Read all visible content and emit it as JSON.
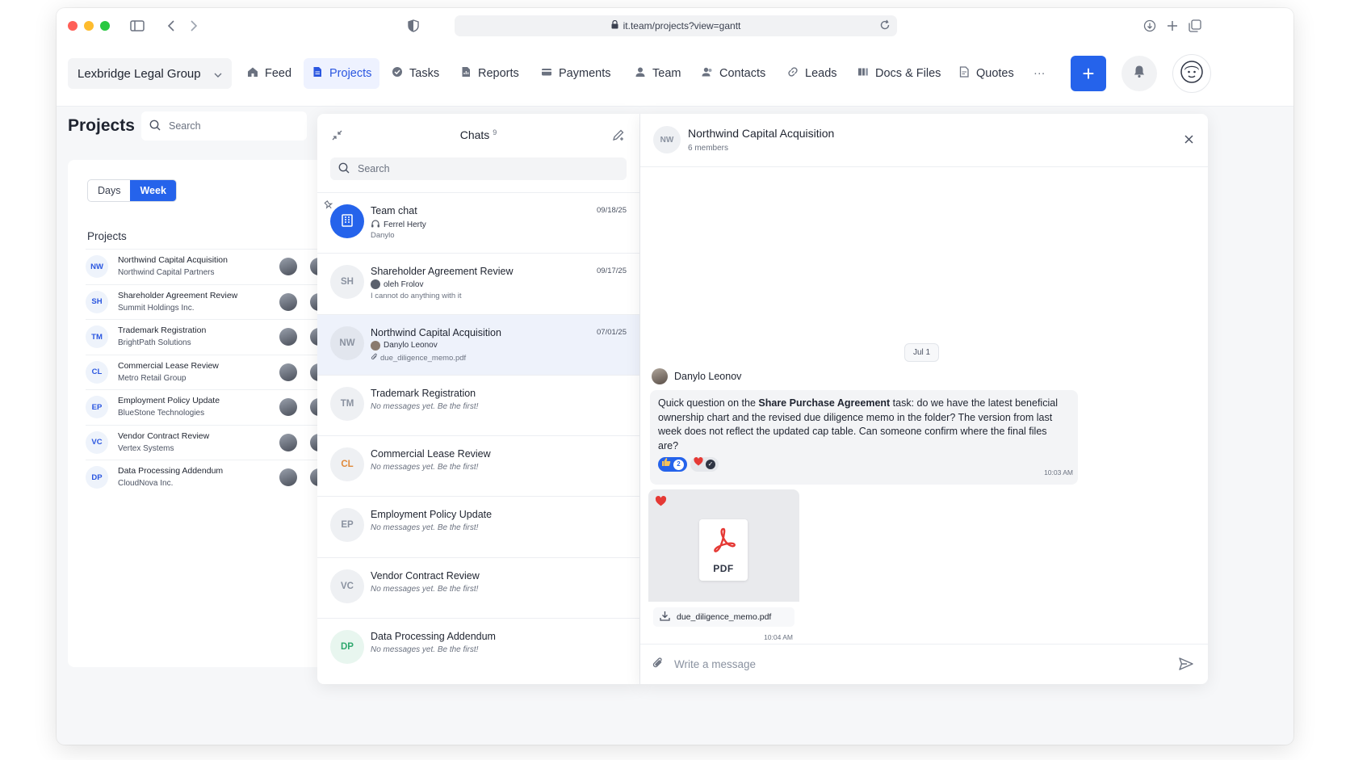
{
  "browser": {
    "url": "it.team/projects?view=gantt"
  },
  "nav": {
    "org": "Lexbridge Legal Group",
    "items": [
      {
        "label": "Feed",
        "icon": "home-icon"
      },
      {
        "label": "Projects",
        "icon": "document-icon",
        "active": true
      },
      {
        "label": "Tasks",
        "icon": "check-circle-icon"
      },
      {
        "label": "Reports",
        "icon": "report-icon"
      },
      {
        "label": "Payments",
        "icon": "card-icon"
      },
      {
        "label": "Team",
        "icon": "person-icon"
      },
      {
        "label": "Contacts",
        "icon": "contacts-icon"
      },
      {
        "label": "Leads",
        "icon": "link-icon"
      },
      {
        "label": "Docs & Files",
        "icon": "files-icon"
      },
      {
        "label": "Quotes",
        "icon": "quote-doc-icon"
      }
    ],
    "more": "···",
    "plus": "+"
  },
  "projects_page": {
    "title": "Projects",
    "search_placeholder": "Search",
    "seg_days": "Days",
    "seg_week": "Week",
    "list_heading": "Projects",
    "rows": [
      {
        "badge": "NW",
        "title": "Northwind Capital Acquisition",
        "client": "Northwind Capital Partners"
      },
      {
        "badge": "SH",
        "title": "Shareholder Agreement Review",
        "client": "Summit Holdings Inc."
      },
      {
        "badge": "TM",
        "title": "Trademark Registration",
        "client": "BrightPath Solutions"
      },
      {
        "badge": "CL",
        "title": "Commercial Lease Review",
        "client": "Metro Retail Group"
      },
      {
        "badge": "EP",
        "title": "Employment Policy Update",
        "client": "BlueStone Technologies"
      },
      {
        "badge": "VC",
        "title": "Vendor Contract Review",
        "client": "Vertex Systems"
      },
      {
        "badge": "DP",
        "title": "Data Processing Addendum",
        "client": "CloudNova Inc."
      }
    ]
  },
  "chats": {
    "title": "Chats",
    "count": "9",
    "search_placeholder": "Search",
    "items": [
      {
        "avatar": "",
        "name": "Team chat",
        "sender": "Ferrel Herty",
        "message": "Danylo",
        "date": "09/18/25"
      },
      {
        "avatar": "SH",
        "name": "Shareholder Agreement Review",
        "sender": "oleh Frolov",
        "message": "I cannot do anything with it",
        "date": "09/17/25"
      },
      {
        "avatar": "NW",
        "name": "Northwind Capital Acquisition",
        "sender": "Danylo Leonov",
        "message": "due_diligence_memo.pdf",
        "date": "07/01/25"
      },
      {
        "avatar": "TM",
        "name": "Trademark Registration",
        "empty": "No messages yet. Be the first!"
      },
      {
        "avatar": "CL",
        "name": "Commercial Lease Review",
        "empty": "No messages yet. Be the first!"
      },
      {
        "avatar": "EP",
        "name": "Employment Policy Update",
        "empty": "No messages yet. Be the first!"
      },
      {
        "avatar": "VC",
        "name": "Vendor Contract Review",
        "empty": "No messages yet. Be the first!"
      },
      {
        "avatar": "DP",
        "name": "Data Processing Addendum",
        "empty": "No messages yet. Be the first!"
      }
    ]
  },
  "conversation": {
    "avatar": "NW",
    "title": "Northwind Capital Acquisition",
    "members": "6 members",
    "date_chip": "Jul 1",
    "sender": "Danylo Leonov",
    "message_pre": "Quick question on the ",
    "message_bold": "Share Purchase Agreement",
    "message_post": " task: do we have the latest beneficial ownership chart and the revised due diligence memo in the folder? The version from last week does not reflect the updated cap table. Can someone confirm where the final files are?",
    "reaction_count": "2",
    "message_time": "10:03 AM",
    "file_type": "PDF",
    "file_name": "due_diligence_memo.pdf",
    "file_time": "10:04 AM",
    "composer_placeholder": "Write a message"
  },
  "colors": {
    "accent": "#2563eb",
    "heart": "#e53935",
    "pdf": "#e53935"
  }
}
